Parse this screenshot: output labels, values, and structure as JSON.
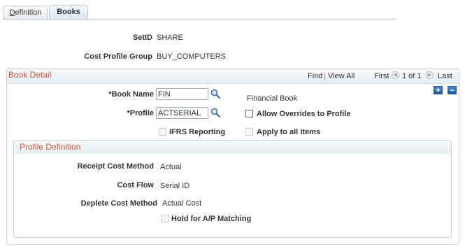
{
  "tabs": {
    "definition": {
      "label_underlined": "D",
      "label_rest": "efinition"
    },
    "books": {
      "label": "Books"
    }
  },
  "header": {
    "setid_label": "SetID",
    "setid_value": "SHARE",
    "cost_profile_group_label": "Cost Profile Group",
    "cost_profile_group_value": "BUY_COMPUTERS"
  },
  "book_detail": {
    "title": "Book Detail",
    "find_label": "Find",
    "separator": "|",
    "view_all_label": "View All",
    "first_label": "First",
    "page_info": "1 of 1",
    "last_label": "Last",
    "add_row_symbol": "+",
    "delete_row_symbol": "−",
    "book_name_label": "*Book Name",
    "book_name_value": "FIN",
    "book_description": "Financial Book",
    "profile_label": "*Profile",
    "profile_value": "ACTSERIAL",
    "allow_overrides_label": "Allow Overrides to Profile",
    "ifrs_label": "IFRS Reporting",
    "apply_all_label": "Apply to all Items"
  },
  "profile_definition": {
    "title": "Profile Definition",
    "receipt_cost_method_label": "Receipt Cost Method",
    "receipt_cost_method_value": "Actual",
    "cost_flow_label": "Cost Flow",
    "cost_flow_value": "Serial ID",
    "deplete_cost_method_label": "Deplete Cost Method",
    "deplete_cost_method_value": "Actual Cost",
    "hold_ap_label": "Hold for A/P Matching"
  },
  "icons": {
    "lookup": "magnifier-icon",
    "prev": "prev-arrow-icon",
    "next": "next-arrow-icon"
  },
  "colors": {
    "section_title": "#c4563a",
    "link": "#1c4f8c",
    "button_blue": "#1f5a9c"
  }
}
